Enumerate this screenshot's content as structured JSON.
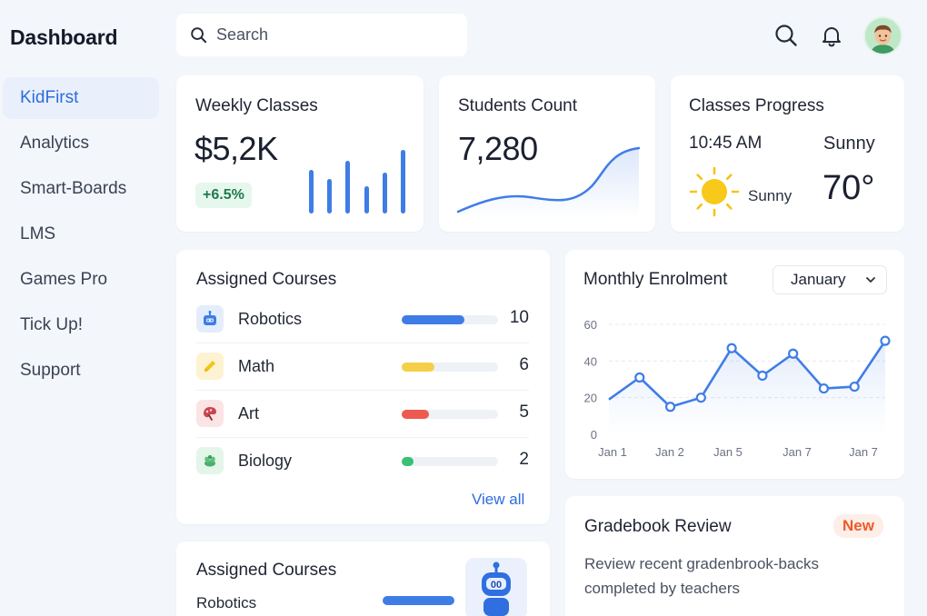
{
  "app": {
    "title": "Dashboard"
  },
  "sidebar": {
    "items": [
      {
        "label": "KidFirst",
        "active": true
      },
      {
        "label": "Analytics"
      },
      {
        "label": "Smart-Boards"
      },
      {
        "label": "LMS"
      },
      {
        "label": "Games Pro"
      },
      {
        "label": "Tick Up!"
      },
      {
        "label": "Support"
      }
    ]
  },
  "search": {
    "placeholder": "Search",
    "icon": "search-icon"
  },
  "header": {
    "icons": [
      "search-icon",
      "bell-icon"
    ],
    "avatar": "user-avatar"
  },
  "colors": {
    "accent": "#3f7de6",
    "positive": "#1e7a4a",
    "new_badge": "#ef5a2a",
    "sun": "#f7c416"
  },
  "weekly_classes": {
    "title": "Weekly Classes",
    "value": "$5,2K",
    "change": "+6.5%",
    "bar_levels": [
      0.66,
      0.53,
      0.81,
      0.41,
      0.62,
      0.97
    ]
  },
  "students_count": {
    "title": "Students Count",
    "value": "7,280"
  },
  "classes_progress": {
    "title": "Classes Progress",
    "time": "10:45 AM",
    "weather_label": "Sunny",
    "weather_condition": "Sunny",
    "temperature": "70°"
  },
  "assigned_courses": {
    "title": "Assigned Courses",
    "rows": [
      {
        "name": "Robotics",
        "value": "10",
        "progress": 0.65,
        "color": "#3f7de6",
        "icon_bg": "#e3edfb",
        "icon": "robot-icon"
      },
      {
        "name": "Math",
        "value": "6",
        "progress": 0.34,
        "color": "#f5cf4a",
        "icon_bg": "#fdf3d2",
        "icon": "pencil-icon"
      },
      {
        "name": "Art",
        "value": "5",
        "progress": 0.28,
        "color": "#ee5a4f",
        "icon_bg": "#fbe4e4",
        "icon": "palette-icon"
      },
      {
        "name": "Biology",
        "value": "2",
        "progress": 0.12,
        "color": "#38c172",
        "icon_bg": "#e4f5e9",
        "icon": "leaf-icon"
      }
    ],
    "view_all": "View all"
  },
  "assigned_courses_2": {
    "title": "Assigned Courses",
    "row_name": "Robotics",
    "icon": "robot-icon"
  },
  "monthly_enrolment": {
    "title": "Monthly Enrolment",
    "selected_month": "January"
  },
  "chart_data": {
    "type": "line",
    "title": "Monthly Enrolment",
    "x": [
      "Jan 1",
      "Jan 2",
      "Jan 5",
      "Jan 7",
      "Jan 7"
    ],
    "x_point_labels": [
      "",
      "Jan 1",
      "",
      "Jan 2",
      "",
      "Jan 5",
      "",
      "Jan 7",
      "",
      "Jan 7",
      ""
    ],
    "yticks": [
      0,
      20,
      40,
      60
    ],
    "ylim": [
      0,
      60
    ],
    "series": [
      {
        "values": [
          19,
          31,
          15,
          20,
          47,
          32,
          44,
          25,
          26,
          51
        ]
      }
    ],
    "grid": true,
    "legend": "none"
  },
  "gradebook": {
    "title": "Gradebook Review",
    "badge": "New",
    "text": "Review recent gradenbrook-backs completed by teachers"
  }
}
